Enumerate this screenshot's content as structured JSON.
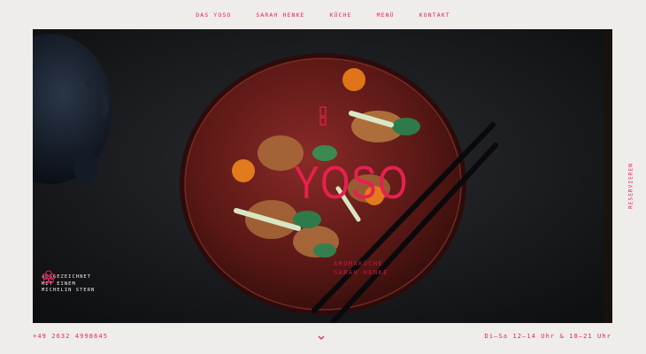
{
  "nav": {
    "items": [
      {
        "label": "DAS YOSO"
      },
      {
        "label": "SARAH HENKE"
      },
      {
        "label": "KÜCHE"
      },
      {
        "label": "MENÜ"
      },
      {
        "label": "KONTAKT"
      }
    ]
  },
  "side": {
    "reserve_label": "RESERVIEREN"
  },
  "hero": {
    "brand": "YOSO",
    "tagline_line1": "AROMAKÜCHE",
    "tagline_line2": "SARAH HENKE",
    "badge_text": "AUSGEZEICHNET MIT EINEM MICHELIN STERN"
  },
  "footer": {
    "phone": "+49 2632 4998645",
    "hours": "Di–Sa 12–14 Uhr & 18–21 Uhr",
    "scroll_icon": "chevron-down-icon"
  },
  "colors": {
    "accent": "#e0245e",
    "background": "#efedea",
    "hero_dark": "#141618"
  }
}
